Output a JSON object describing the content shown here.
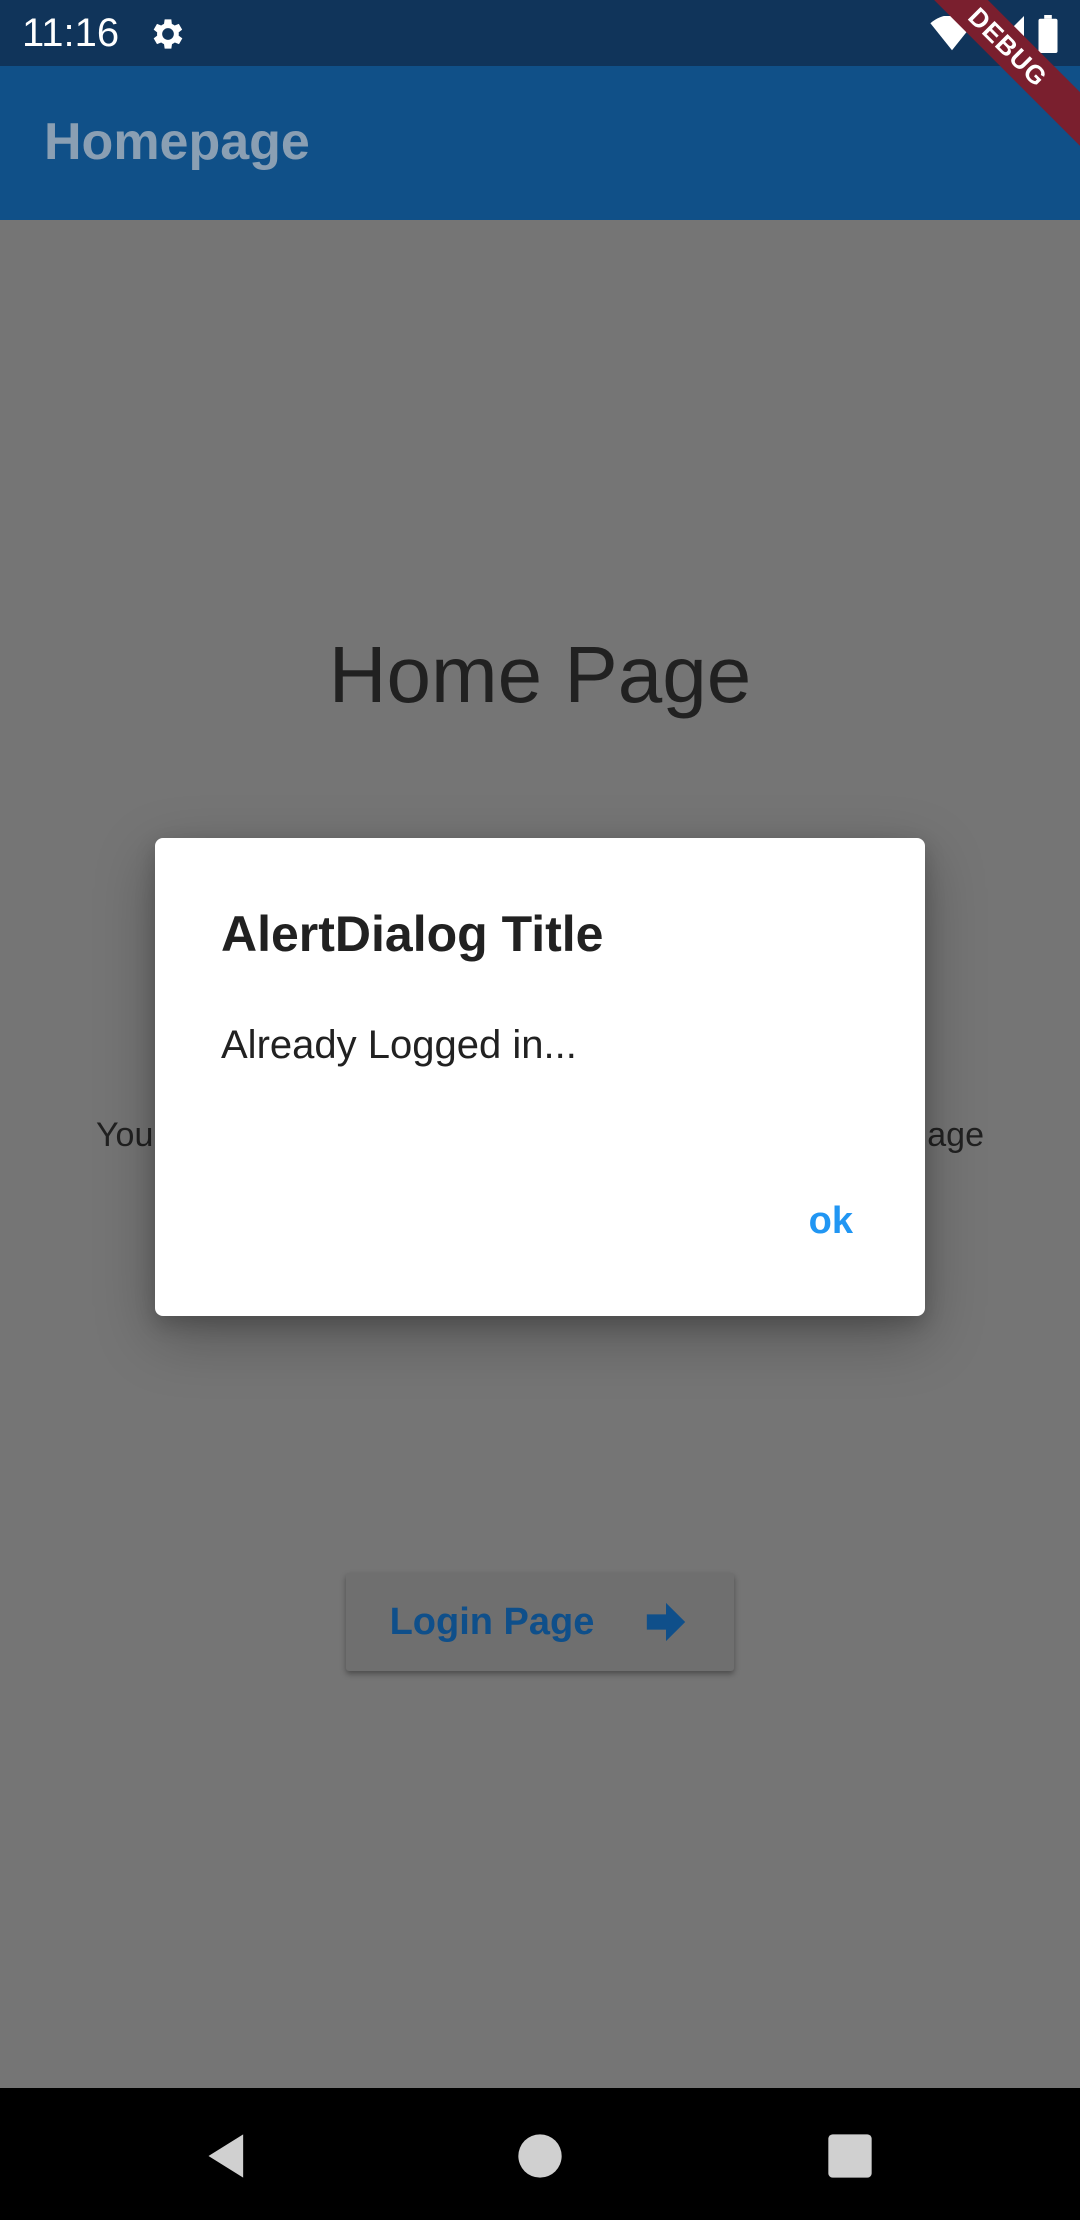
{
  "status_bar": {
    "time": "11:16",
    "icons": [
      "settings-icon",
      "wifi-icon",
      "signal-icon",
      "battery-icon"
    ]
  },
  "debug_banner": {
    "label": "DEBUG"
  },
  "app_bar": {
    "title": "Homepage"
  },
  "main": {
    "heading": "Home Page",
    "partial_text_left": "You",
    "partial_text_right": "age",
    "login_button": {
      "label": "Login Page",
      "icon": "arrow-forward-icon"
    }
  },
  "dialog": {
    "title": "AlertDialog Title",
    "content": "Already Logged in...",
    "ok_label": "ok"
  },
  "nav_bar": {
    "buttons": [
      "back-icon",
      "home-icon",
      "recents-icon"
    ]
  },
  "colors": {
    "status_bar": "#10345a",
    "app_bar": "#105088",
    "scrim_background": "#757575",
    "dialog_action": "#2196f3",
    "debug_banner": "#7a1f2e"
  }
}
